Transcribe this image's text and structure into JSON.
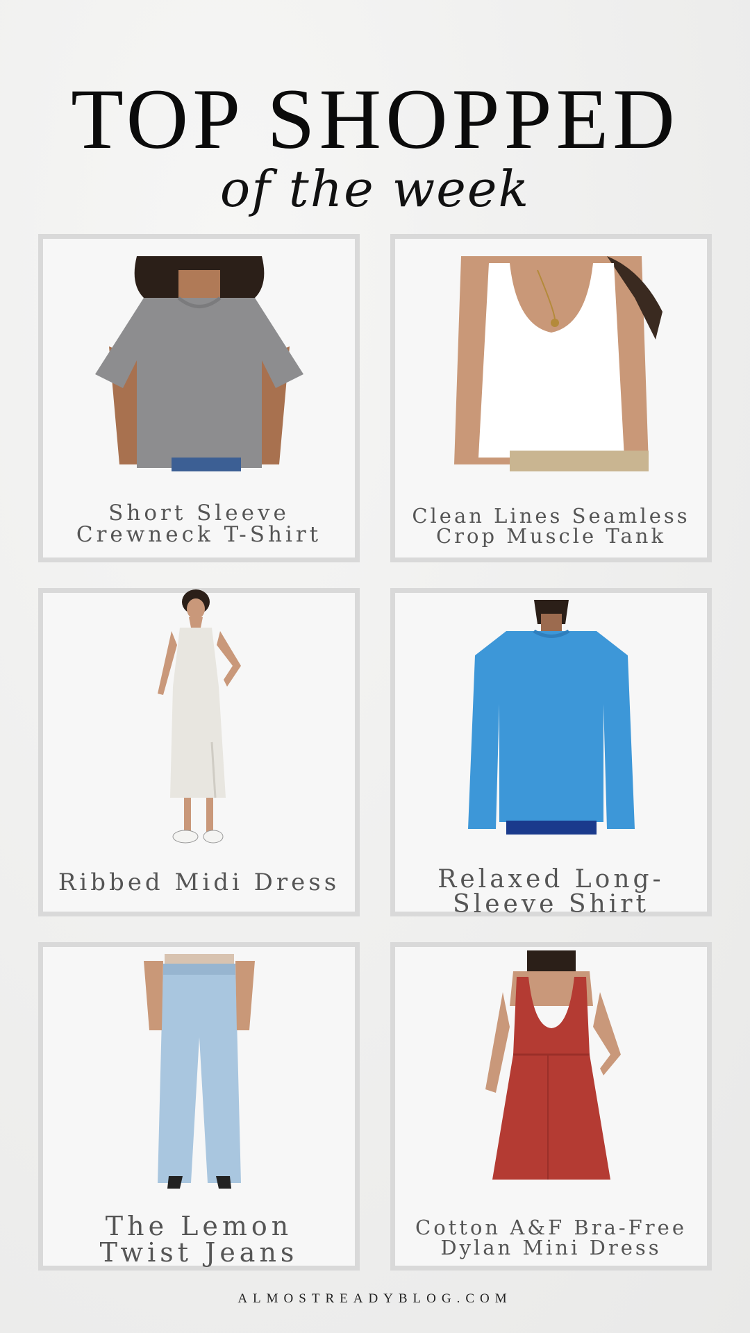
{
  "header": {
    "title": "TOP SHOPPED",
    "subtitle": "of the week"
  },
  "products": [
    {
      "line1": "Short Sleeve",
      "line2": "Crewneck T-Shirt",
      "image": "gray-tshirt-photo",
      "color": "#8d8d8f"
    },
    {
      "line1": "Clean Lines Seamless",
      "line2": "Crop Muscle Tank",
      "image": "white-tank-photo",
      "color": "#ffffff"
    },
    {
      "line1": "Ribbed Midi Dress",
      "line2": "",
      "image": "ribbed-midi-dress-photo",
      "color": "#e8e6e0"
    },
    {
      "line1": "Relaxed Long-",
      "line2": "Sleeve Shirt",
      "image": "blue-longsleeve-photo",
      "color": "#3d97d8"
    },
    {
      "line1": "The Lemon",
      "line2": "Twist Jeans",
      "image": "wide-leg-jeans-photo",
      "color": "#a9c6df"
    },
    {
      "line1": "Cotton A&F Bra-Free",
      "line2": "Dylan Mini Dress",
      "image": "red-mini-dress-photo",
      "color": "#b43b33"
    }
  ],
  "footer": {
    "text": "ALMOSTREADYBLOG.COM"
  }
}
